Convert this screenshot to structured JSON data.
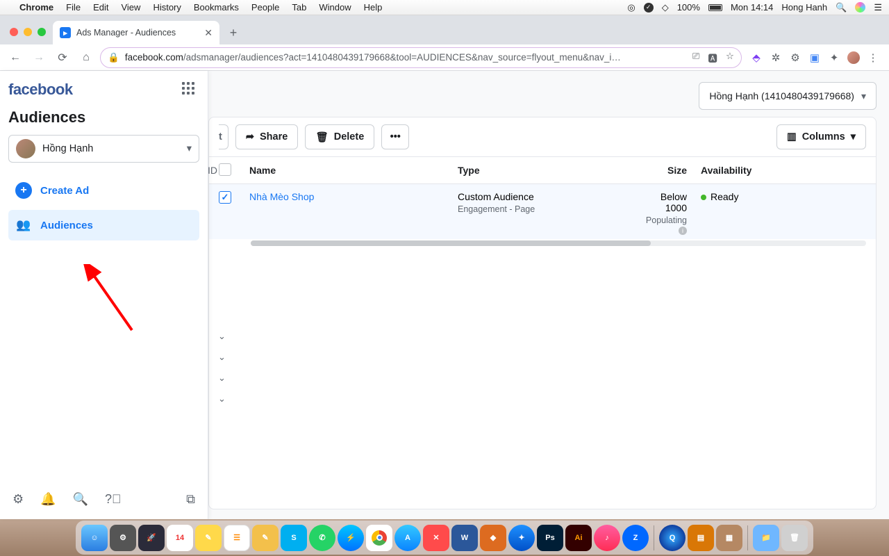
{
  "menubar": {
    "app": "Chrome",
    "items": [
      "File",
      "Edit",
      "View",
      "History",
      "Bookmarks",
      "People",
      "Tab",
      "Window",
      "Help"
    ],
    "battery": "100%",
    "clock": "Mon 14:14",
    "user": "Hong Hanh"
  },
  "browser": {
    "tab_title": "Ads Manager - Audiences",
    "url": "facebook.com/adsmanager/audiences?act=1410480439179668&tool=AUDIENCES&nav_source=flyout_menu&nav_i…"
  },
  "sidebar": {
    "logo": "facebook",
    "title": "Audiences",
    "account": "Hồng Hạnh",
    "create_ad": "Create Ad",
    "audiences": "Audiences"
  },
  "main": {
    "account_badge": "Hồng Hạnh (1410480439179668)",
    "toolbar": {
      "trunc": "t",
      "id": "ID",
      "share": "Share",
      "delete": "Delete",
      "columns": "Columns"
    },
    "table": {
      "headers": {
        "name": "Name",
        "type": "Type",
        "size": "Size",
        "availability": "Availability"
      },
      "rows": [
        {
          "name": "Nhà Mèo Shop",
          "type": "Custom Audience",
          "type_sub": "Engagement - Page",
          "size": "Below 1000",
          "size_sub": "Populating",
          "availability": "Ready"
        }
      ]
    }
  }
}
